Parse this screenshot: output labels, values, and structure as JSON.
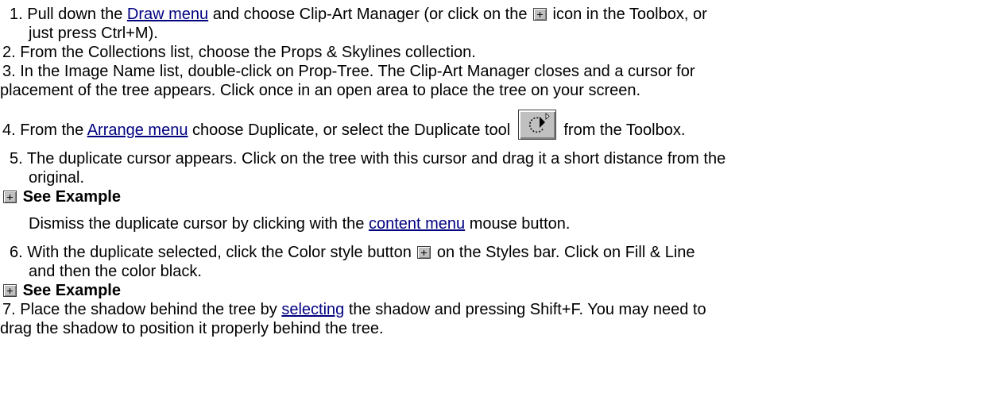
{
  "steps": {
    "s1": {
      "a": "1.  Pull down the ",
      "link": "Draw menu",
      "b": " and choose Clip-Art Manager (or click on the ",
      "c": " icon in the Toolbox, or",
      "d": "just press Ctrl+M)."
    },
    "s2": {
      "a": "2.  From the Collections list, choose the Props & Skylines collection."
    },
    "s3": {
      "a": "3.  In the Image Name list, double-click on Prop-Tree.   The Clip-Art Manager closes and a cursor for",
      "b": "placement of the tree appears.   Click once in an open area to place the tree on your screen."
    },
    "s4": {
      "a": "4.  From the ",
      "link": "Arrange menu",
      "b": " choose Duplicate, or select the Duplicate tool ",
      "c": " from the Toolbox."
    },
    "s5": {
      "a": "5.  The duplicate cursor appears.   Click on the tree with this cursor and drag it a short distance from the",
      "b": "original."
    },
    "example1": "See Example",
    "dismiss": {
      "a": "Dismiss the duplicate cursor by clicking with the ",
      "link": "content menu",
      "b": " mouse button."
    },
    "s6": {
      "a": "6.  With the duplicate selected, click the Color style button ",
      "b": " on the Styles bar.   Click on Fill & Line",
      "c": "and then the color black."
    },
    "example2": "See Example",
    "s7": {
      "a": "7.  Place the shadow behind the tree by ",
      "link": "selecting",
      "b": " the shadow and pressing Shift+F.   You may need to",
      "c": "drag the shadow to position it properly behind the tree."
    }
  },
  "icons": {
    "clip_art_icon": "plus-box-icon",
    "duplicate_tool_icon": "duplicate-tool-icon",
    "example_icon": "plus-box-icon",
    "color_style_icon": "plus-box-icon"
  },
  "colors": {
    "link": "#000080",
    "text": "#000000",
    "background": "#ffffff"
  }
}
